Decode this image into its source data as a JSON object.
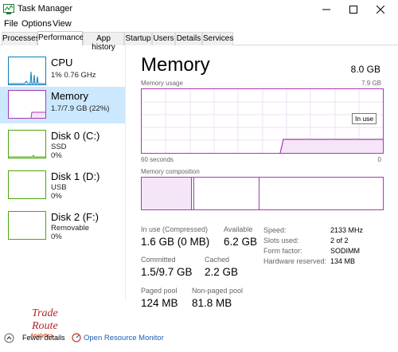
{
  "window": {
    "title": "Task Manager"
  },
  "menu": {
    "file": "File",
    "options": "Options",
    "view": "View"
  },
  "tabs": [
    "Processes",
    "Performance",
    "App history",
    "Startup",
    "Users",
    "Details",
    "Services"
  ],
  "sidebar": {
    "items": [
      {
        "title": "CPU",
        "sub1": "1%  0.76 GHz",
        "sub2": "",
        "color": "#117dbb"
      },
      {
        "title": "Memory",
        "sub1": "1.7/7.9 GB (22%)",
        "sub2": "",
        "color": "#8b12ae"
      },
      {
        "title": "Disk 0 (C:)",
        "sub1": "SSD",
        "sub2": "0%",
        "color": "#4da60c"
      },
      {
        "title": "Disk 1 (D:)",
        "sub1": "USB",
        "sub2": "0%",
        "color": "#4da60c"
      },
      {
        "title": "Disk 2 (F:)",
        "sub1": "Removable",
        "sub2": "0%",
        "color": "#4da60c"
      }
    ]
  },
  "main": {
    "title": "Memory",
    "total": "8.0 GB",
    "usage_label": "Memory usage",
    "usage_max": "7.9 GB",
    "time_left": "60 seconds",
    "time_right": "0",
    "tooltip": "In use",
    "composition_label": "Memory composition",
    "stats": {
      "inuse_label": "In use (Compressed)",
      "inuse_value": "1.6 GB (0 MB)",
      "available_label": "Available",
      "available_value": "6.2 GB",
      "committed_label": "Committed",
      "committed_value": "1.5/9.7 GB",
      "cached_label": "Cached",
      "cached_value": "2.2 GB",
      "paged_label": "Paged pool",
      "paged_value": "124 MB",
      "nonpaged_label": "Non-paged pool",
      "nonpaged_value": "81.8 MB"
    },
    "details": [
      {
        "label": "Speed:",
        "value": "2133 MHz"
      },
      {
        "label": "Slots used:",
        "value": "2 of 2"
      },
      {
        "label": "Form factor:",
        "value": "SODIMM"
      },
      {
        "label": "Hardware reserved:",
        "value": "134 MB"
      }
    ]
  },
  "footer": {
    "fewer_details": "Fewer details",
    "open_resource_monitor": "Open Resource Monitor",
    "logo_line1": "Trade",
    "logo_line2": "Route",
    "logo_line3": "Analytics"
  },
  "colors": {
    "memory_accent": "#a63ab2",
    "selected_bg": "#cce8ff",
    "link": "#1a5fb4"
  }
}
